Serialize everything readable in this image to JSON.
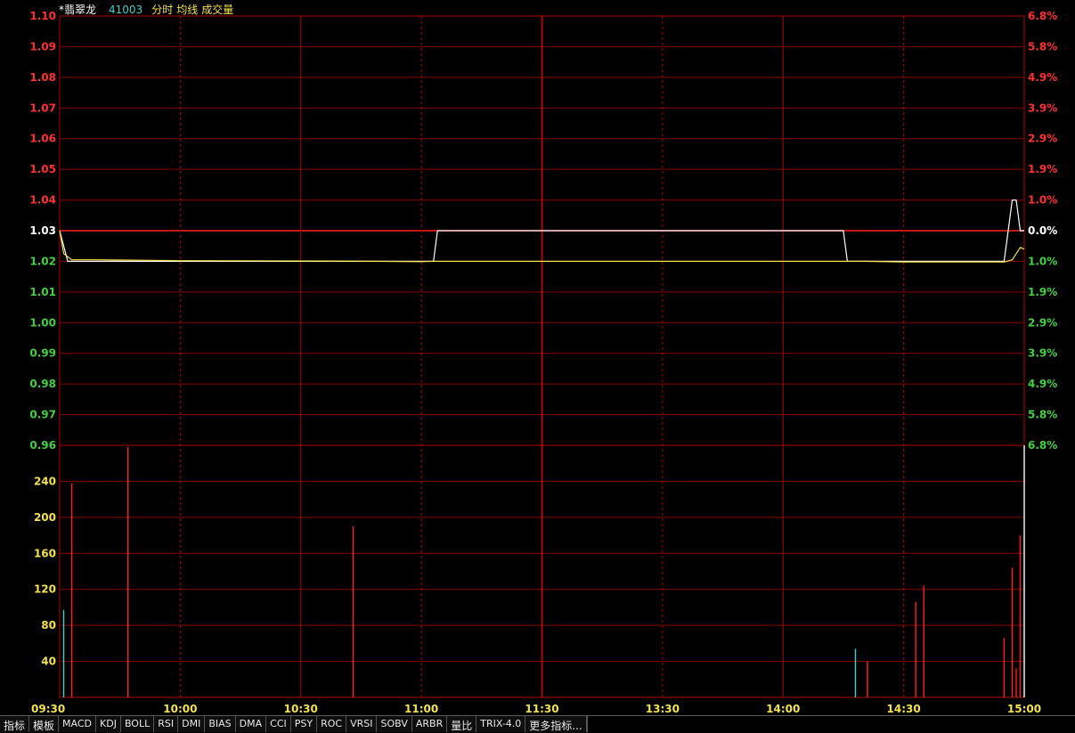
{
  "header": {
    "stock_name": "*翡翠龙",
    "stock_code": "41003",
    "labels": [
      "分时",
      "均线",
      "成交量"
    ]
  },
  "colors": {
    "grid": "#8b0000",
    "grid_major": "#b00000",
    "up": "#ff3030",
    "down": "#43d043",
    "neutral": "#ffffff",
    "volume_axis": "#f4e24a",
    "price_line": "#ffffff",
    "avg_line": "#f4e24a",
    "volume_up": "#ff2020",
    "volume_down": "#3ecfcf"
  },
  "chart_data": {
    "type": "line",
    "prev_close": 1.03,
    "price_axis": {
      "ticks": [
        "1.10",
        "1.09",
        "1.08",
        "1.07",
        "1.06",
        "1.05",
        "1.04",
        "1.03",
        "1.02",
        "1.01",
        "1.00",
        "0.99",
        "0.98",
        "0.97",
        "0.96"
      ],
      "ylim": [
        0.96,
        1.1
      ]
    },
    "pct_axis": {
      "ticks": [
        "6.8%",
        "5.8%",
        "4.9%",
        "3.9%",
        "2.9%",
        "1.9%",
        "1.0%",
        "0.0%",
        "1.0%",
        "1.9%",
        "2.9%",
        "3.9%",
        "4.9%",
        "5.8%",
        "6.8%"
      ]
    },
    "volume_axis": {
      "ticks": [
        "240",
        "200",
        "160",
        "120",
        "80",
        "40"
      ],
      "ylim": [
        0,
        280
      ]
    },
    "time_ticks": [
      "09:30",
      "10:00",
      "10:30",
      "11:00",
      "11:30",
      "13:30",
      "14:00",
      "14:30",
      "15:00"
    ],
    "series": [
      {
        "name": "分时",
        "x": [
          0,
          2,
          3,
          93,
          94,
          95,
          118,
          119,
          120,
          195,
          196,
          197,
          235,
          236,
          237,
          238,
          239,
          240
        ],
        "y": [
          1.03,
          1.02,
          1.02,
          1.02,
          1.03,
          1.03,
          1.03,
          1.03,
          1.03,
          1.03,
          1.02,
          1.02,
          1.02,
          1.03,
          1.04,
          1.04,
          1.03,
          1.03
        ]
      },
      {
        "name": "均线",
        "x": [
          0,
          1,
          3,
          10,
          30,
          70,
          90,
          93,
          120,
          200,
          210,
          235,
          237,
          239,
          240
        ],
        "y": [
          1.03,
          1.0225,
          1.0205,
          1.0205,
          1.0202,
          1.0201,
          1.0199,
          1.02,
          1.02,
          1.02,
          1.0198,
          1.0198,
          1.0205,
          1.0245,
          1.024
        ]
      }
    ],
    "volume": [
      {
        "x": 1,
        "v": 97,
        "dir": "down"
      },
      {
        "x": 3,
        "v": 238,
        "dir": "up"
      },
      {
        "x": 17,
        "v": 278,
        "dir": "up"
      },
      {
        "x": 73,
        "v": 190,
        "dir": "up"
      },
      {
        "x": 198,
        "v": 54,
        "dir": "down"
      },
      {
        "x": 201,
        "v": 40,
        "dir": "up"
      },
      {
        "x": 213,
        "v": 106,
        "dir": "up"
      },
      {
        "x": 215,
        "v": 124,
        "dir": "up"
      },
      {
        "x": 235,
        "v": 66,
        "dir": "up"
      },
      {
        "x": 237,
        "v": 144,
        "dir": "up"
      },
      {
        "x": 238,
        "v": 32,
        "dir": "up"
      },
      {
        "x": 239,
        "v": 180,
        "dir": "up"
      },
      {
        "x": 240,
        "v": 280,
        "dir": "neutral"
      }
    ]
  },
  "tabs": [
    "指标",
    "模板",
    "MACD",
    "KDJ",
    "BOLL",
    "RSI",
    "DMI",
    "BIAS",
    "DMA",
    "CCI",
    "PSY",
    "ROC",
    "VRSI",
    "SOBV",
    "ARBR",
    "量比",
    "TRIX-4.0",
    "更多指标..."
  ]
}
